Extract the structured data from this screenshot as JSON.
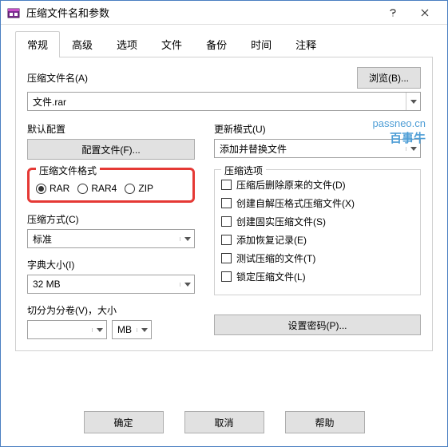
{
  "title": "压缩文件名和参数",
  "tabs": [
    "常规",
    "高级",
    "选项",
    "文件",
    "备份",
    "时间",
    "注释"
  ],
  "labels": {
    "filename": "压缩文件名(A)",
    "browse": "浏览(B)...",
    "default_profile": "默认配置",
    "profile_btn": "配置文件(F)...",
    "update_mode": "更新模式(U)",
    "format_group": "压缩文件格式",
    "options_group": "压缩选项",
    "method": "压缩方式(C)",
    "dict": "字典大小(I)",
    "split": "切分为分卷(V)，大小",
    "set_password": "设置密码(P)..."
  },
  "filename_value": "文件.rar",
  "update_mode_value": "添加并替换文件",
  "formats": {
    "rar": "RAR",
    "rar4": "RAR4",
    "zip": "ZIP"
  },
  "options": {
    "delete_after": "压缩后删除原来的文件(D)",
    "create_sfx": "创建自解压格式压缩文件(X)",
    "create_solid": "创建固实压缩文件(S)",
    "add_recovery": "添加恢复记录(E)",
    "test_archive": "测试压缩的文件(T)",
    "lock_archive": "锁定压缩文件(L)"
  },
  "method_value": "标准",
  "dict_value": "32 MB",
  "split_unit": "MB",
  "watermark": {
    "l1": "passneo.cn",
    "l2": "百事牛"
  },
  "footer": {
    "ok": "确定",
    "cancel": "取消",
    "help": "帮助"
  }
}
